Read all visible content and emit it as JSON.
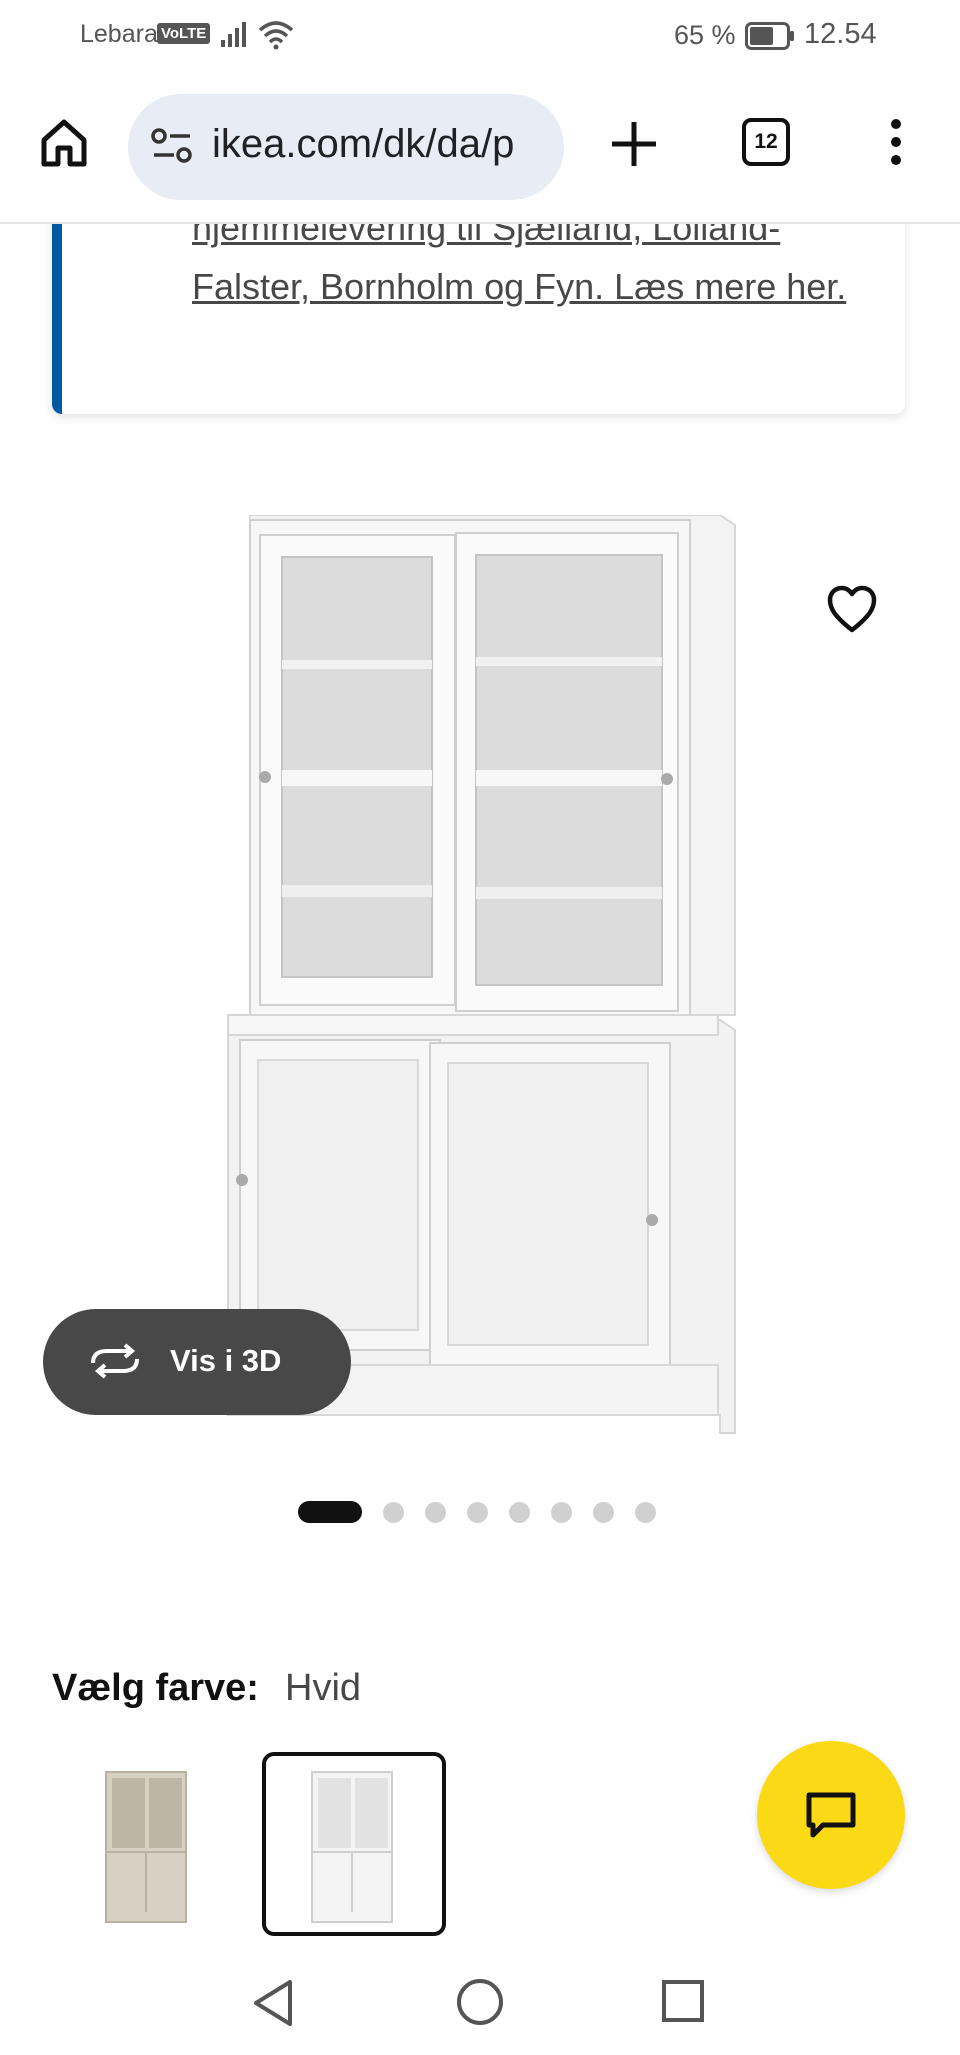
{
  "status_bar": {
    "carrier": "Lebara",
    "volte": "VoLTE",
    "battery_percent": "65 %",
    "time": "12.54",
    "signal_icon": "signal-bars-icon",
    "wifi_icon": "wifi-icon",
    "battery_icon": "battery-icon",
    "battery_level": 0.65
  },
  "browser": {
    "url": "ikea.com/dk/da/p",
    "tab_count": "12",
    "home_icon": "home-icon",
    "site_settings_icon": "tune-icon",
    "new_tab_icon": "plus-icon",
    "menu_icon": "more-vert-icon"
  },
  "notice": {
    "text": "hjemmelevering til Sjælland, Lolland-Falster, Bornholm og Fyn. Læs mere her.",
    "accent_color": "#0058a3"
  },
  "product": {
    "favorite_icon": "heart-icon",
    "view_3d_label": "Vis i 3D",
    "view_3d_icon": "rotate-3d-icon",
    "carousel": {
      "total": 8,
      "active_index": 0
    }
  },
  "color_choice": {
    "label": "Vælg farve:",
    "selected": "Hvid",
    "swatches": [
      {
        "name": "beige",
        "color": "#d7d1c4",
        "selected": false
      },
      {
        "name": "white",
        "color": "#f4f4f4",
        "selected": true
      }
    ]
  },
  "chat": {
    "icon": "chat-icon",
    "color": "#fbd914"
  },
  "nav": {
    "back_icon": "back-triangle-icon",
    "home_icon": "home-circle-icon",
    "recent_icon": "recent-square-icon"
  }
}
